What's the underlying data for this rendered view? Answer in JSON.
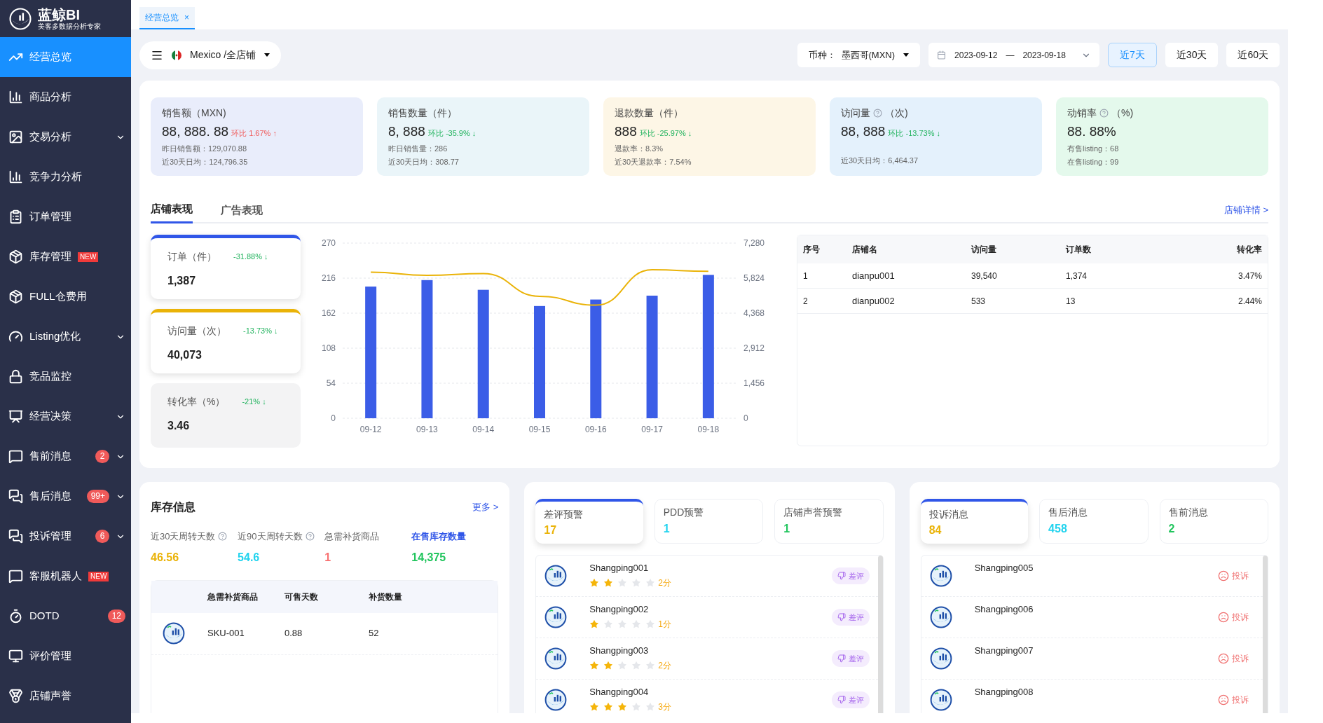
{
  "logo": {
    "title": "蓝鲸BI",
    "subtitle": "美客多数据分析专家"
  },
  "sidebar": {
    "items": [
      {
        "label": "经营总览",
        "kind": "plain",
        "selected": true,
        "expandable": false
      },
      {
        "label": "商品分析",
        "kind": "plain",
        "selected": false,
        "expandable": false
      },
      {
        "label": "交易分析",
        "kind": "plain",
        "selected": false,
        "expandable": true
      },
      {
        "label": "竞争力分析",
        "kind": "plain",
        "selected": false,
        "expandable": false
      },
      {
        "label": "订单管理",
        "kind": "plain",
        "selected": false,
        "expandable": false
      },
      {
        "label": "库存管理",
        "kind": "tagged",
        "selected": false,
        "expandable": false,
        "badge": "NEW"
      },
      {
        "label": "FULL仓费用",
        "kind": "plain",
        "selected": false,
        "expandable": false
      },
      {
        "label": "Listing优化",
        "kind": "plain",
        "selected": false,
        "expandable": true
      },
      {
        "label": "竞品监控",
        "kind": "plain",
        "selected": false,
        "expandable": false
      },
      {
        "label": "经营决策",
        "kind": "plain",
        "selected": false,
        "expandable": true
      },
      {
        "label": "售前消息",
        "kind": "counted",
        "selected": false,
        "expandable": true,
        "badge": "2"
      },
      {
        "label": "售后消息",
        "kind": "counted",
        "selected": false,
        "expandable": true,
        "badge": "99+"
      },
      {
        "label": "投诉管理",
        "kind": "counted",
        "selected": false,
        "expandable": true,
        "badge": "6"
      },
      {
        "label": "客服机器人",
        "kind": "tagged",
        "selected": false,
        "expandable": false,
        "badge": "NEW"
      },
      {
        "label": "DOTD",
        "kind": "counted",
        "selected": false,
        "expandable": false,
        "badge": "12"
      },
      {
        "label": "评价管理",
        "kind": "plain",
        "selected": false,
        "expandable": false
      },
      {
        "label": "店铺声誉",
        "kind": "plain",
        "selected": false,
        "expandable": false
      }
    ]
  },
  "page_tabs": [
    {
      "label": "经营总览",
      "selected": true,
      "close": "×"
    }
  ],
  "store_selector": {
    "value": "Mexico /全店铺"
  },
  "currency": {
    "label": "币种：",
    "value": "墨西哥(MXN)"
  },
  "date_range": {
    "start": "2023-09-12",
    "separator": "—",
    "end": "2023-09-18"
  },
  "range_buttons": [
    {
      "label": "近7天",
      "selected": true
    },
    {
      "label": "近30天",
      "selected": false
    },
    {
      "label": "近60天",
      "selected": false
    }
  ],
  "kpis": [
    {
      "title": "销售额（MXN)",
      "help": false,
      "value": "88, 888. 88",
      "change": "环比 1.67% ↑",
      "kind": "rise",
      "lines": [
        "昨日销售额：129,070.88",
        "近30天日均：124,796.35"
      ],
      "color": "#e9edfb"
    },
    {
      "title": "销售数量（件）",
      "help": false,
      "value": "8, 888",
      "change": "环比 -35.9% ↓",
      "kind": "fall",
      "lines": [
        "昨日销售量：286",
        "近30天日均：308.77"
      ],
      "color": "#eaf5f9"
    },
    {
      "title": "退款数量（件）",
      "help": false,
      "value": "888",
      "change": "环比 -25.97% ↓",
      "kind": "fall",
      "lines": [
        "退款率：8.3%",
        "近30天退款率：7.54%"
      ],
      "color": "#fdf6e6"
    },
    {
      "title": "访问量",
      "unit": "（次)",
      "help": true,
      "value": "88, 888",
      "change": "环比 -13.73% ↓",
      "kind": "fall",
      "lines": [
        "近30天日均：6,464.37"
      ],
      "color": "#e4f1fc"
    },
    {
      "title": "动销率",
      "unit": "（%)",
      "help": true,
      "value": "88. 88%",
      "lines": [
        "有售listing：68",
        "在售listing：99"
      ],
      "color": "#e4f9ec"
    }
  ],
  "section_tabs": [
    {
      "label": "店铺表现",
      "selected": true
    },
    {
      "label": "广告表现",
      "selected": false
    }
  ],
  "store_details_link": "店铺详情 >",
  "metrics": [
    {
      "title": "订单（件）",
      "change": "-31.88% ↓",
      "value": "1,387",
      "selected": true,
      "color": "#3056e8"
    },
    {
      "title": "访问量（次）",
      "change": "-13.73% ↓",
      "value": "40,073",
      "selected": true,
      "color": "#eab308"
    },
    {
      "title": "转化率（%）",
      "change": "-21% ↓",
      "value": "3.46",
      "selected": false
    }
  ],
  "orders_chart": {
    "chart_data": {
      "type": "bar",
      "categories": [
        "09-12",
        "09-13",
        "09-14",
        "09-15",
        "09-16",
        "09-17",
        "09-18"
      ],
      "series": [
        {
          "color": "#3b5de7",
          "values": [
            203,
            213,
            198,
            173,
            183,
            189,
            221
          ]
        }
      ],
      "ylim": [
        0,
        270
      ],
      "yticks": [
        0,
        54,
        108,
        162,
        216,
        270
      ],
      "grid": true
    }
  },
  "visits_chart": {
    "chart_data": {
      "type": "line",
      "series": [
        {
          "color": "#eab308",
          "values": [
            6070,
            5940,
            6010,
            5070,
            4700,
            6170,
            6110
          ]
        }
      ],
      "ylim": [
        0,
        7280
      ],
      "yticks": [
        {
          "value": 0,
          "label": "0"
        },
        {
          "value": 1456,
          "label": "1,456"
        },
        {
          "value": 2912,
          "label": "2,912"
        },
        {
          "value": 4368,
          "label": "4,368"
        },
        {
          "value": 5824,
          "label": "5,824"
        },
        {
          "value": 7280,
          "label": "7,280"
        }
      ]
    }
  },
  "store_table": {
    "columns": [
      "序号",
      "店铺名",
      "访问量",
      "订单数",
      "转化率"
    ],
    "rows": [
      [
        "1",
        "dianpu001",
        "39,540",
        "1,374",
        "3.47%"
      ],
      [
        "2",
        "dianpu002",
        "533",
        "13",
        "2.44%"
      ]
    ]
  },
  "inventory": {
    "title": "库存信息",
    "more": "更多 >",
    "stats": [
      {
        "label": "近30天周转天数",
        "help": true,
        "value": "46.56",
        "color": "#eab308",
        "emphasis": false
      },
      {
        "label": "近90天周转天数",
        "help": true,
        "value": "54.6",
        "color": "#22d3ee",
        "emphasis": false
      },
      {
        "label": "急需补货商品",
        "help": false,
        "value": "1",
        "color": "#f87171",
        "emphasis": false
      },
      {
        "label": "在售库存数量",
        "help": false,
        "value": "14,375",
        "color": "#22c55e",
        "emphasis": true
      }
    ],
    "table": {
      "columns": [
        "急需补货商品",
        "可售天数",
        "补货数量"
      ],
      "rows": [
        [
          "SKU-001",
          "0.88",
          "52"
        ]
      ]
    }
  },
  "review_panel": {
    "tabs": [
      {
        "label": "差评预警",
        "count": "17",
        "color": "#eab308",
        "selected": true
      },
      {
        "label": "PDD预警",
        "count": "1",
        "color": "#22d3ee",
        "selected": false
      },
      {
        "label": "店铺声誉预警",
        "count": "1",
        "color": "#22c55e",
        "selected": false
      }
    ],
    "items": [
      {
        "name": "Shangping001",
        "stars": 2,
        "score": "2分",
        "tag": "差评"
      },
      {
        "name": "Shangping002",
        "stars": 1,
        "score": "1分",
        "tag": "差评"
      },
      {
        "name": "Shangping003",
        "stars": 2,
        "score": "2分",
        "tag": "差评"
      },
      {
        "name": "Shangping004",
        "stars": 3,
        "score": "3分",
        "tag": "差评"
      }
    ]
  },
  "message_panel": {
    "tabs": [
      {
        "label": "投诉消息",
        "count": "84",
        "color": "#eab308",
        "selected": true
      },
      {
        "label": "售后消息",
        "count": "458",
        "color": "#22d3ee",
        "selected": false
      },
      {
        "label": "售前消息",
        "count": "2",
        "color": "#22c55e",
        "selected": false
      }
    ],
    "items": [
      {
        "name": "Shangping005",
        "tag": "投诉"
      },
      {
        "name": "Shangping006",
        "tag": "投诉"
      },
      {
        "name": "Shangping007",
        "tag": "投诉"
      },
      {
        "name": "Shangping008",
        "tag": "投诉"
      }
    ]
  }
}
